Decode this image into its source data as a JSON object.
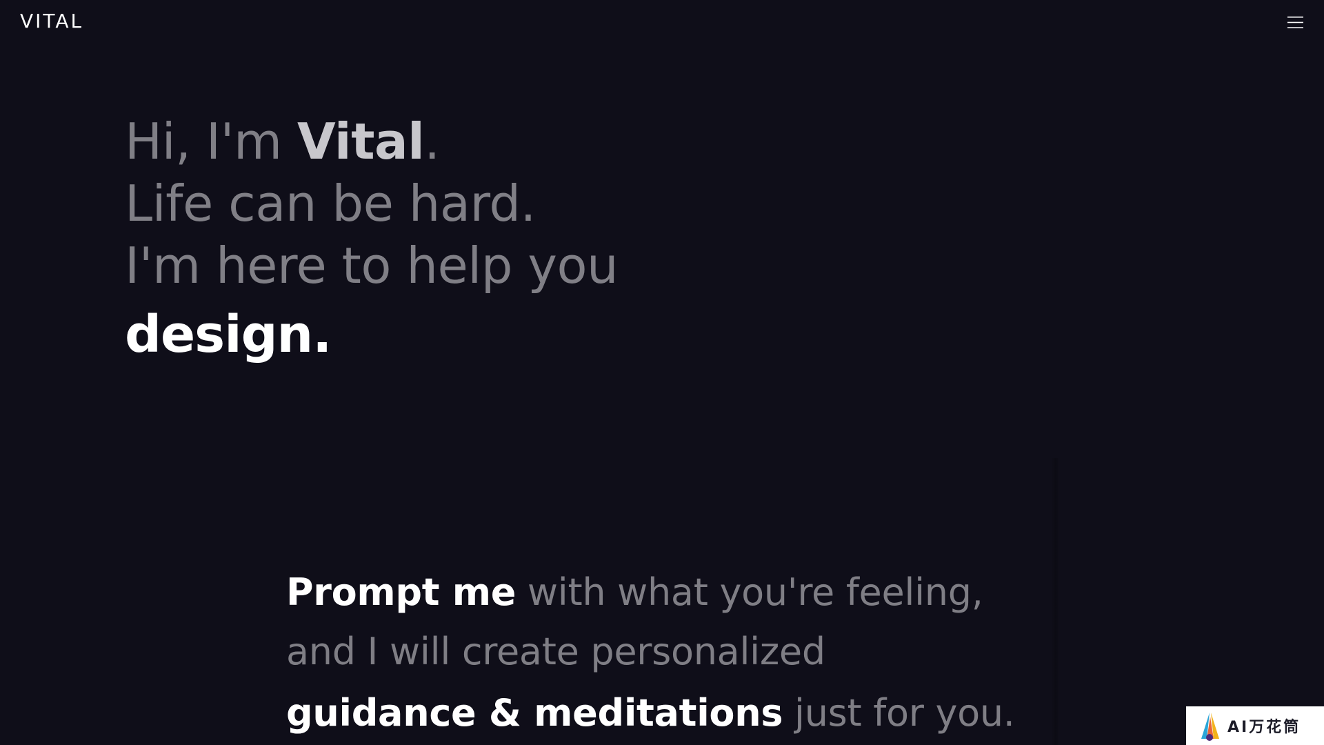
{
  "header": {
    "logo_text": "VITAL",
    "menu_icon": "hamburger-menu-icon"
  },
  "hero": {
    "greeting_prefix": "Hi, I'm ",
    "greeting_name": "Vital",
    "greeting_suffix": ".",
    "line2": "Life can be hard.",
    "line3": "I'm here to help you",
    "rotating_word": "design."
  },
  "prompt": {
    "strong1": "Prompt me",
    "rest1": " with what you're feeling,",
    "line2": "and I will create personalized",
    "strong3": "guidance & meditations",
    "rest3": " just for you."
  },
  "watermark": {
    "text": "AI万花筒"
  },
  "colors": {
    "background": "#0f0e19",
    "text_strong": "#ffffff",
    "text_muted": "#807f86"
  }
}
